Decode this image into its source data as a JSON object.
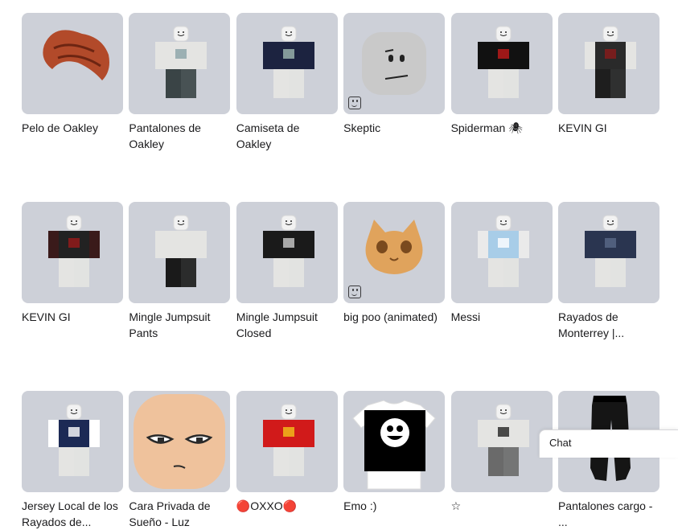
{
  "items": [
    {
      "name": "Pelo de Oakley",
      "art": "hair",
      "colors": {
        "main": "#b24a2a",
        "dark": "#6d2512"
      }
    },
    {
      "name": "Pantalones de Oakley",
      "art": "avatar",
      "colors": {
        "torso": "#e4e4e2",
        "arms": "#e4e4e2",
        "legs": "#3a4446",
        "accent": "#8aa3a8"
      }
    },
    {
      "name": "Camiseta de Oakley",
      "art": "avatar",
      "colors": {
        "torso": "#1c2340",
        "arms": "#1c2340",
        "legs": "#e4e4e2",
        "accent": "#9fb8b0"
      }
    },
    {
      "name": "Skeptic",
      "art": "face",
      "badge": "face-icon",
      "colors": {
        "main": "#c9c9c9"
      }
    },
    {
      "name": "Spiderman 🕷",
      "art": "avatar",
      "colors": {
        "torso": "#111111",
        "arms": "#111111",
        "legs": "#e4e4e2",
        "accent": "#c21a1a"
      }
    },
    {
      "name": "KEVIN GI",
      "art": "avatar",
      "colors": {
        "torso": "#2a2a2a",
        "arms": "#e4e4e2",
        "legs": "#1e1e1e",
        "accent": "#8a1a1a"
      }
    },
    {
      "name": "KEVIN GI",
      "art": "avatar",
      "colors": {
        "torso": "#222222",
        "arms": "#3a1a1a",
        "legs": "#e4e4e2",
        "accent": "#9a1a1a"
      }
    },
    {
      "name": "Mingle Jumpsuit Pants",
      "art": "avatar",
      "colors": {
        "torso": "#e4e4e2",
        "arms": "#e4e4e2",
        "legs": "#1a1a1a",
        "accent": "#e4e4e2"
      }
    },
    {
      "name": "Mingle Jumpsuit Closed",
      "art": "avatar",
      "colors": {
        "torso": "#1a1a1a",
        "arms": "#1a1a1a",
        "legs": "#e4e4e2",
        "accent": "#cccccc"
      }
    },
    {
      "name": "big poo (animated)",
      "art": "cat",
      "badge": "face-icon",
      "colors": {
        "main": "#e0a35c",
        "dark": "#7a4a1e"
      }
    },
    {
      "name": "Messi",
      "art": "avatar",
      "colors": {
        "torso": "#a8cde8",
        "arms": "#eaeaea",
        "legs": "#e4e4e2",
        "accent": "#ffffff"
      }
    },
    {
      "name": "Rayados de Monterrey |...",
      "art": "avatar",
      "colors": {
        "torso": "#2a3550",
        "arms": "#2a3550",
        "legs": "#e4e4e2",
        "accent": "#5a6a88"
      }
    },
    {
      "name": "Jersey Local de los Rayados de...",
      "art": "avatar",
      "colors": {
        "torso": "#1c2a55",
        "arms": "#ffffff",
        "legs": "#e4e4e2",
        "accent": "#ffffff"
      }
    },
    {
      "name": "Cara Privada de Sueño - Luz",
      "art": "bighead",
      "colors": {
        "main": "#efc29c",
        "dark": "#2a2a2a"
      }
    },
    {
      "name": "🔴OXXO🔴",
      "art": "avatar",
      "colors": {
        "torso": "#d11a1a",
        "arms": "#d11a1a",
        "legs": "#e4e4e2",
        "accent": "#f2c21a"
      }
    },
    {
      "name": "Emo :)",
      "art": "tshirt",
      "colors": {
        "main": "#ffffff",
        "dark": "#000000"
      }
    },
    {
      "name": "☆",
      "art": "avatar",
      "colors": {
        "torso": "#e4e4e2",
        "arms": "#e4e4e2",
        "legs": "#6a6a6a",
        "accent": "#222222"
      }
    },
    {
      "name": "Pantalones cargo - ...",
      "art": "pants",
      "colors": {
        "main": "#151515",
        "dark": "#000000"
      }
    }
  ],
  "chat": {
    "label": "Chat"
  }
}
